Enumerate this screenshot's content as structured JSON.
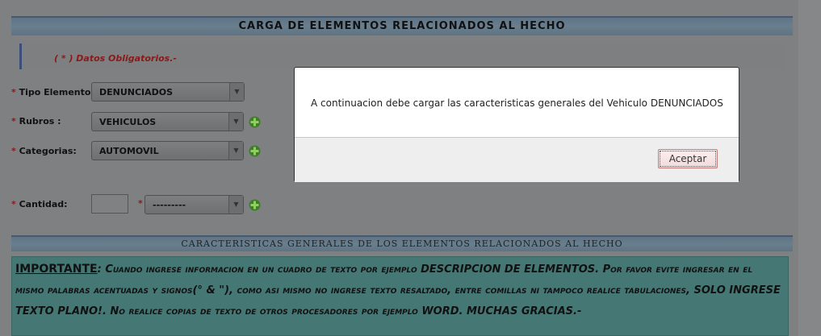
{
  "header": {
    "title": "CARGA DE ELEMENTOS RELACIONADOS AL HECHO"
  },
  "required_note": "( * ) Datos Obligatorios.-",
  "form": {
    "required_mark": "*",
    "tipo_elemento": {
      "label": "Tipo Elemento :",
      "value": "DENUNCIADOS"
    },
    "rubros": {
      "label": "Rubros :",
      "value": "VEHICULOS"
    },
    "categorias": {
      "label": "Categorias:",
      "value": "AUTOMOVIL"
    },
    "cantidad": {
      "label": "Cantidad:",
      "value": "",
      "unit_value": "---------"
    }
  },
  "section2": {
    "title": "CARACTERISTICAS GENERALES DE LOS ELEMENTOS RELACIONADOS AL HECHO"
  },
  "important": {
    "title": "IMPORTANTE",
    "colon": ":",
    "p1": " Cuando ingrese informacion en un cuadro de texto por ejemplo ",
    "e1": "DESCRIPCION DE ELEMENTOS.",
    "p2": " Por favor evite ingresar en el mismo palabras acentuadas y signos(",
    "e2": "° & \")",
    "p3": ", como asi mismo no ingrese texto resaltado, entre comillas ni tampoco realice tabulaciones, ",
    "e3": "SOLO INGRESE TEXTO PLANO!.",
    "p4": " No realice copias de texto de otros procesadores por ejemplo ",
    "e4": "WORD. MUCHAS GRACIAS.-"
  },
  "dialog": {
    "message": "A continuacion debe cargar las caracteristicas generales del Vehiculo DENUNCIADOS",
    "accept_label": "Aceptar"
  },
  "icons": {
    "add": "plus-icon",
    "dropdown": "chevron-down-icon"
  },
  "colors": {
    "required": "#8a1a1a",
    "plus": "#4e9a2e",
    "dialog_button_border": "#c77c7c"
  }
}
